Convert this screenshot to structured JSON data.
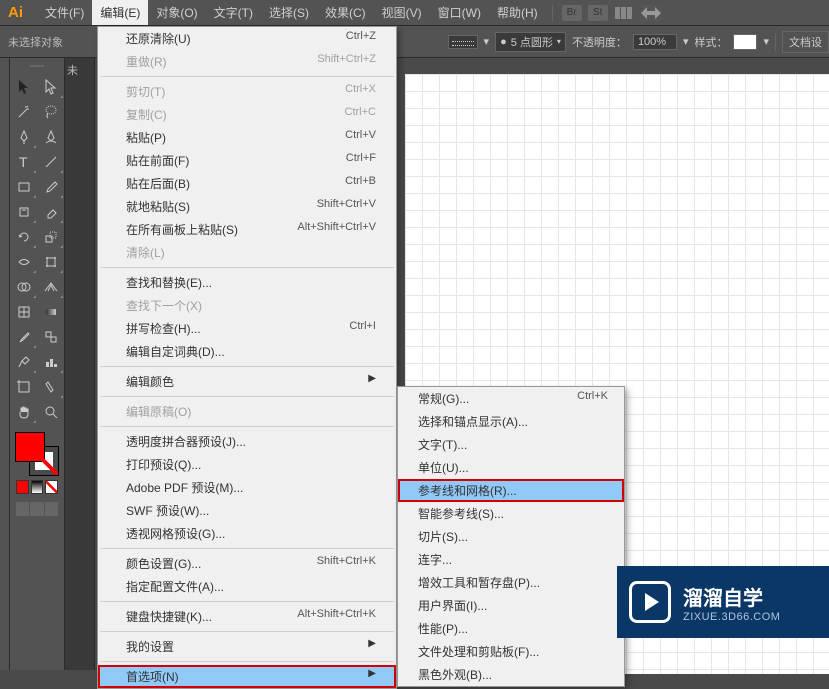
{
  "app": {
    "logo": "Ai"
  },
  "menubar": {
    "items": [
      "文件(F)",
      "编辑(E)",
      "对象(O)",
      "文字(T)",
      "选择(S)",
      "效果(C)",
      "视图(V)",
      "窗口(W)",
      "帮助(H)"
    ],
    "active_index": 1,
    "right_icons": [
      "Br",
      "St"
    ]
  },
  "controlbar": {
    "no_selection": "未选择对象",
    "stroke_label": "5 点圆形",
    "opacity_label": "不透明度：",
    "opacity_value": "100%",
    "style_label": "样式：",
    "doc_setup": "文档设"
  },
  "tabbar": {
    "unsaved": "未"
  },
  "edit_menu": {
    "items": [
      {
        "label": "还原清除(U)",
        "shortcut": "Ctrl+Z"
      },
      {
        "label": "重做(R)",
        "shortcut": "Shift+Ctrl+Z",
        "disabled": true
      },
      {
        "sep": true
      },
      {
        "label": "剪切(T)",
        "shortcut": "Ctrl+X",
        "disabled": true
      },
      {
        "label": "复制(C)",
        "shortcut": "Ctrl+C",
        "disabled": true
      },
      {
        "label": "粘贴(P)",
        "shortcut": "Ctrl+V"
      },
      {
        "label": "贴在前面(F)",
        "shortcut": "Ctrl+F"
      },
      {
        "label": "贴在后面(B)",
        "shortcut": "Ctrl+B"
      },
      {
        "label": "就地粘贴(S)",
        "shortcut": "Shift+Ctrl+V"
      },
      {
        "label": "在所有画板上粘贴(S)",
        "shortcut": "Alt+Shift+Ctrl+V"
      },
      {
        "label": "清除(L)",
        "disabled": true
      },
      {
        "sep": true
      },
      {
        "label": "查找和替换(E)..."
      },
      {
        "label": "查找下一个(X)",
        "disabled": true
      },
      {
        "label": "拼写检查(H)...",
        "shortcut": "Ctrl+I"
      },
      {
        "label": "编辑自定词典(D)..."
      },
      {
        "sep": true
      },
      {
        "label": "编辑颜色",
        "submenu": true
      },
      {
        "sep": true
      },
      {
        "label": "编辑原稿(O)",
        "disabled": true
      },
      {
        "sep": true
      },
      {
        "label": "透明度拼合器预设(J)..."
      },
      {
        "label": "打印预设(Q)..."
      },
      {
        "label": "Adobe PDF 预设(M)..."
      },
      {
        "label": "SWF 预设(W)..."
      },
      {
        "label": "透视网格预设(G)..."
      },
      {
        "sep": true
      },
      {
        "label": "颜色设置(G)...",
        "shortcut": "Shift+Ctrl+K"
      },
      {
        "label": "指定配置文件(A)..."
      },
      {
        "sep": true
      },
      {
        "label": "键盘快捷键(K)...",
        "shortcut": "Alt+Shift+Ctrl+K"
      },
      {
        "sep": true
      },
      {
        "label": "我的设置",
        "submenu": true
      },
      {
        "sep": true
      },
      {
        "label": "首选项(N)",
        "submenu": true,
        "highlighted": true,
        "hover": true
      }
    ]
  },
  "prefs_submenu": {
    "items": [
      {
        "label": "常规(G)...",
        "shortcut": "Ctrl+K"
      },
      {
        "label": "选择和锚点显示(A)..."
      },
      {
        "label": "文字(T)..."
      },
      {
        "label": "单位(U)..."
      },
      {
        "label": "参考线和网格(R)...",
        "highlighted": true,
        "hover": true
      },
      {
        "label": "智能参考线(S)..."
      },
      {
        "label": "切片(S)..."
      },
      {
        "label": "连字..."
      },
      {
        "label": "增效工具和暂存盘(P)..."
      },
      {
        "label": "用户界面(I)..."
      },
      {
        "label": "性能(P)..."
      },
      {
        "label": "文件处理和剪贴板(F)..."
      },
      {
        "label": "黑色外观(B)..."
      }
    ]
  },
  "watermark": {
    "title": "溜溜自学",
    "url": "ZIXUE.3D66.COM"
  }
}
